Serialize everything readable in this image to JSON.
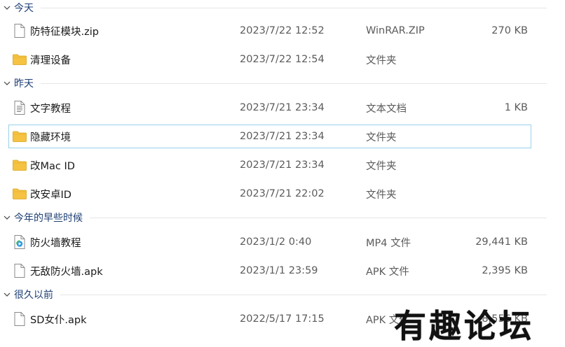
{
  "groups": [
    {
      "label": "今天",
      "items": [
        {
          "name": "防特征模块.zip",
          "date": "2023/7/22 12:52",
          "type": "WinRAR.ZIP",
          "size": "270 KB",
          "icon": "zip-file-icon"
        },
        {
          "name": "清理设备",
          "date": "2023/7/22 12:54",
          "type": "文件夹",
          "size": "",
          "icon": "folder-icon"
        }
      ]
    },
    {
      "label": "昨天",
      "items": [
        {
          "name": "文字教程",
          "date": "2023/7/21 23:34",
          "type": "文本文档",
          "size": "1 KB",
          "icon": "text-file-icon"
        },
        {
          "name": "隐藏环境",
          "date": "2023/7/21 23:34",
          "type": "文件夹",
          "size": "",
          "icon": "folder-icon"
        },
        {
          "name": "改Mac ID",
          "date": "2023/7/21 23:34",
          "type": "文件夹",
          "size": "",
          "icon": "folder-icon"
        },
        {
          "name": "改安卓ID",
          "date": "2023/7/21 22:02",
          "type": "文件夹",
          "size": "",
          "icon": "folder-icon"
        }
      ]
    },
    {
      "label": "今年的早些时候",
      "items": [
        {
          "name": "防火墙教程",
          "date": "2023/1/2 0:40",
          "type": "MP4 文件",
          "size": "29,441 KB",
          "icon": "video-file-icon"
        },
        {
          "name": "无敌防火墙.apk",
          "date": "2023/1/1 23:59",
          "type": "APK 文件",
          "size": "2,395 KB",
          "icon": "apk-file-icon"
        }
      ]
    },
    {
      "label": "很久以前",
      "items": [
        {
          "name": "SD女仆.apk",
          "date": "2022/5/17 17:15",
          "type": "APK 文件",
          "size": "8,556 KB",
          "icon": "apk-file-icon"
        }
      ]
    }
  ],
  "watermark": "有趣论坛",
  "colors": {
    "group_header": "#1e3f73",
    "selection_border": "#99d1ec",
    "folder": "#f5c242",
    "secondary_text": "#5b5b5b"
  }
}
